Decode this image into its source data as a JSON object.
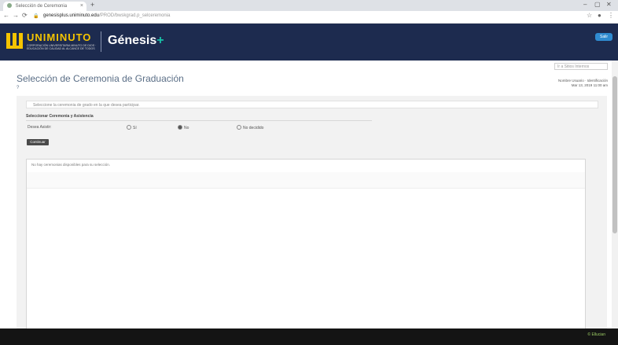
{
  "browser": {
    "tab_title": "Selección de Ceremonia",
    "tab_close": "×",
    "new_tab": "+",
    "url_host": "genesisplus.uniminuto.edu",
    "url_path": "/PROD/bwskgrad.p_selceremonia",
    "minimize": "–",
    "maximize": "▢",
    "close": "✕",
    "back": "←",
    "forward": "→",
    "reload": "⟳",
    "lock": "🔒",
    "star": "☆",
    "profile": "●",
    "menu": "⋮"
  },
  "header": {
    "logo_name": "UNIMINUTO",
    "logo_subtitle": "CORPORACIÓN UNIVERSITARIA MINUTO DE DIOS · EDUCACIÓN DE CALIDAD AL ALCANCE DE TODOS",
    "brand_main": "Génesis",
    "brand_plus": "+",
    "button_label": "Salir",
    "brand_color": "#1d2b4f",
    "accent_color": "#f5c400"
  },
  "page": {
    "search_placeholder": "Ir a Sitios Internos",
    "title": "Selección de Ceremonia de Graduación",
    "user_line1": "Nombre Usuario · Identificación",
    "user_line2": "Mar 13, 2019 11:00 am",
    "help_icon": "?"
  },
  "form": {
    "info_message": "Seleccione la ceremonia de grado en la que desea participar.",
    "section_title": "Seleccionar Ceremonia y Asistencia",
    "row_label": "Desea Asistir:",
    "options": [
      {
        "label": "Sí"
      },
      {
        "label": "No"
      },
      {
        "label": "No decidido"
      }
    ],
    "continue_button": "Continuar",
    "results_message": "No hay ceremonias disponibles para su selección."
  },
  "footer": {
    "text": "© Ellucian"
  }
}
